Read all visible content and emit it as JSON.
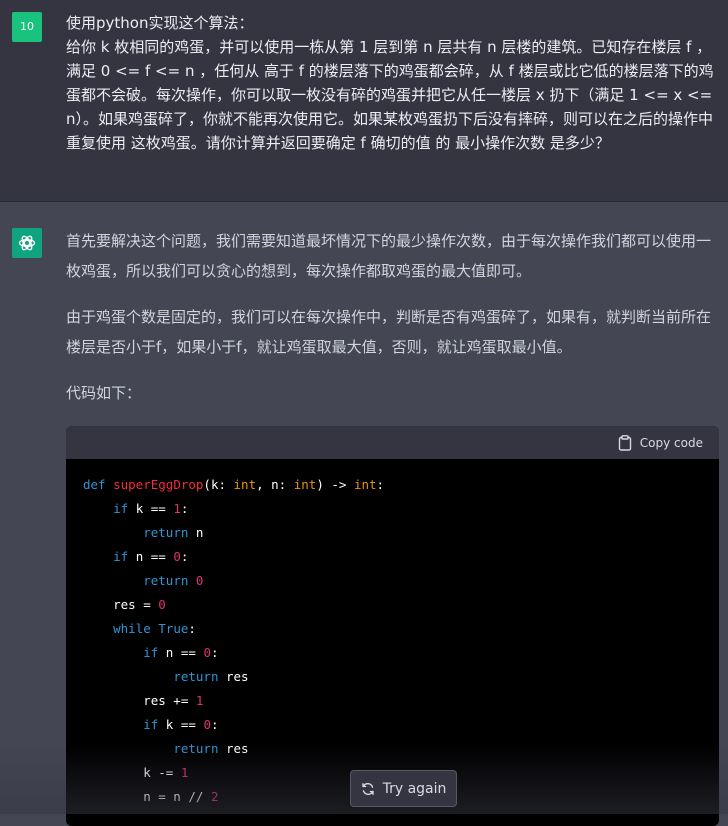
{
  "user": {
    "avatar_label": "10",
    "message": "使用python实现这个算法：\n给你 k 枚相同的鸡蛋，并可以使用一栋从第 1 层到第 n 层共有 n 层楼的建筑。已知存在楼层 f ，满足 0 <= f <= n ，任何从 高于 f 的楼层落下的鸡蛋都会碎，从 f 楼层或比它低的楼层落下的鸡蛋都不会破。每次操作，你可以取一枚没有碎的鸡蛋并把它从任一楼层 x 扔下（满足 1 <= x <= n）。如果鸡蛋碎了，你就不能再次使用它。如果某枚鸡蛋扔下后没有摔碎，则可以在之后的操作中 重复使用 这枚鸡蛋。请你计算并返回要确定 f 确切的值 的 最小操作次数 是多少？"
  },
  "assistant": {
    "avatar_icon": "openai-logo-icon",
    "paragraphs": [
      "首先要解决这个问题，我们需要知道最坏情况下的最少操作次数，由于每次操作我们都可以使用一枚鸡蛋，所以我们可以贪心的想到，每次操作都取鸡蛋的最大值即可。",
      "由于鸡蛋个数是固定的，我们可以在每次操作中，判断是否有鸡蛋碎了，如果有，就判断当前所在楼层是否小于f，如果小于f，就让鸡蛋取最大值，否则，就让鸡蛋取最小值。",
      "代码如下："
    ],
    "code_block": {
      "copy_label": "Copy code",
      "copy_icon": "clipboard-icon",
      "lines": [
        [
          {
            "t": "def",
            "c": "kw"
          },
          {
            "t": " "
          },
          {
            "t": "superEggDrop",
            "c": "fn"
          },
          {
            "t": "(k: "
          },
          {
            "t": "int",
            "c": "ty"
          },
          {
            "t": ", n: "
          },
          {
            "t": "int",
            "c": "ty"
          },
          {
            "t": ") -> "
          },
          {
            "t": "int",
            "c": "ty"
          },
          {
            "t": ":"
          }
        ],
        [
          {
            "t": "    "
          },
          {
            "t": "if",
            "c": "kw"
          },
          {
            "t": " k == "
          },
          {
            "t": "1",
            "c": "num"
          },
          {
            "t": ":"
          }
        ],
        [
          {
            "t": "        "
          },
          {
            "t": "return",
            "c": "kw"
          },
          {
            "t": " n"
          }
        ],
        [
          {
            "t": "    "
          },
          {
            "t": "if",
            "c": "kw"
          },
          {
            "t": " n == "
          },
          {
            "t": "0",
            "c": "num"
          },
          {
            "t": ":"
          }
        ],
        [
          {
            "t": "        "
          },
          {
            "t": "return",
            "c": "kw"
          },
          {
            "t": " "
          },
          {
            "t": "0",
            "c": "num"
          }
        ],
        [
          {
            "t": "    res = "
          },
          {
            "t": "0",
            "c": "num"
          }
        ],
        [
          {
            "t": "    "
          },
          {
            "t": "while",
            "c": "kw"
          },
          {
            "t": " "
          },
          {
            "t": "True",
            "c": "kw"
          },
          {
            "t": ":"
          }
        ],
        [
          {
            "t": "        "
          },
          {
            "t": "if",
            "c": "kw"
          },
          {
            "t": " n == "
          },
          {
            "t": "0",
            "c": "num"
          },
          {
            "t": ":"
          }
        ],
        [
          {
            "t": "            "
          },
          {
            "t": "return",
            "c": "kw"
          },
          {
            "t": " res"
          }
        ],
        [
          {
            "t": "        res += "
          },
          {
            "t": "1",
            "c": "num"
          }
        ],
        [
          {
            "t": "        "
          },
          {
            "t": "if",
            "c": "kw"
          },
          {
            "t": " k == "
          },
          {
            "t": "0",
            "c": "num"
          },
          {
            "t": ":"
          }
        ],
        [
          {
            "t": "            "
          },
          {
            "t": "return",
            "c": "kw"
          },
          {
            "t": " res"
          }
        ],
        [
          {
            "t": "        k -= "
          },
          {
            "t": "1",
            "c": "num"
          }
        ],
        [
          {
            "t": "        n = n // "
          },
          {
            "t": "2",
            "c": "num"
          }
        ]
      ]
    }
  },
  "actions": {
    "try_again_label": "Try again",
    "try_again_icon": "refresh-icon"
  },
  "colors": {
    "user_bg": "#343541",
    "assistant_bg": "#444654",
    "accent": "#10a37f",
    "code_bg": "#000000"
  }
}
